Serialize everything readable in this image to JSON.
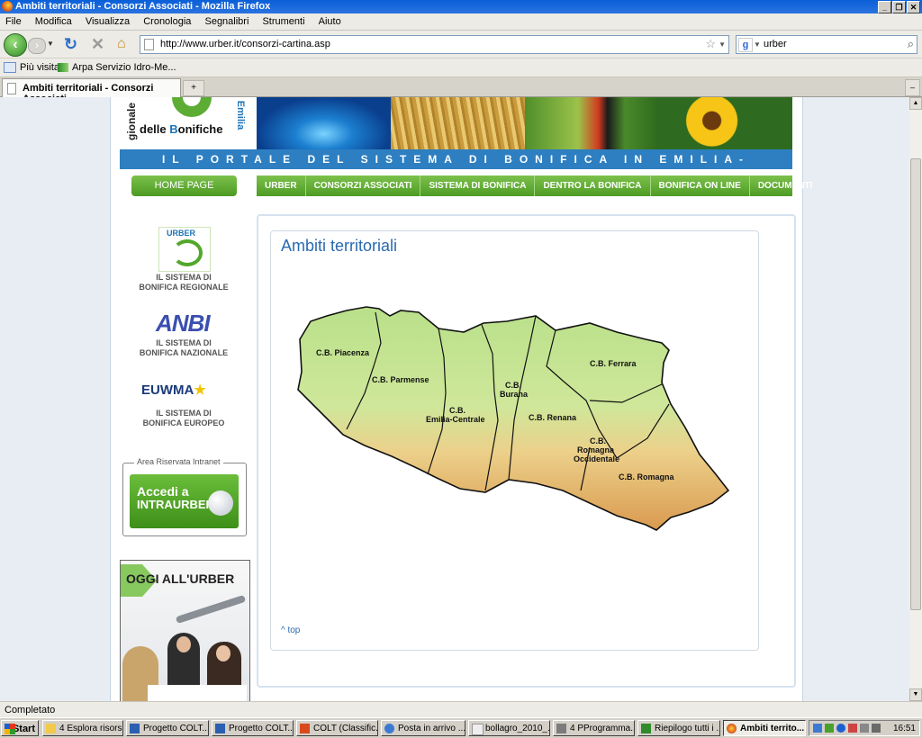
{
  "window": {
    "title": "Ambiti territoriali - Consorzi Associati - Mozilla Firefox",
    "controls": [
      "_",
      "❐",
      "✕"
    ]
  },
  "menu": [
    "File",
    "Modifica",
    "Visualizza",
    "Cronologia",
    "Segnalibri",
    "Strumenti",
    "Aiuto"
  ],
  "nav": {
    "url": "http://www.urber.it/consorzi-cartina.asp",
    "search_value": "urber",
    "search_engine": "g"
  },
  "bookmarks": [
    {
      "label": "Più visitati",
      "icon": "page-icon"
    },
    {
      "label": "Arpa Servizio Idro-Me...",
      "icon": "wave-icon"
    }
  ],
  "tabs": [
    {
      "label": "Ambiti territoriali - Consorzi Associati"
    }
  ],
  "site": {
    "logo": {
      "vertical_left": "gionale",
      "main_part1": "delle ",
      "main_b1": "B",
      "main_part2": "onifiche",
      "vertical_right": "Emilia"
    },
    "banner": "IL PORTALE DEL SISTEMA DI BONIFICA IN EMILIA-ROMAGNA",
    "home_button": "HOME PAGE",
    "topnav": [
      "URBER",
      "CONSORZI ASSOCIATI",
      "SISTEMA DI BONIFICA",
      "DENTRO LA BONIFICA",
      "BONIFICA ON LINE",
      "DOCUMENTI"
    ],
    "sidebar": {
      "urber_logo_text": "URBER",
      "urber_caption": [
        "IL SISTEMA DI",
        "BONIFICA REGIONALE"
      ],
      "anbi_logo_text": "ANBI",
      "anbi_caption": [
        "IL SISTEMA DI",
        "BONIFICA NAZIONALE"
      ],
      "euwma_logo_text": "EUWMA",
      "euwma_caption": [
        "IL SISTEMA DI",
        "BONIFICA EUROPEO"
      ],
      "intranet_legend": "Area Riservata Intranet",
      "intranet_line1": "Accedi a",
      "intranet_line2": "INTRAURBER",
      "oggi_title": "OGGI ALL'URBER"
    },
    "content": {
      "title": "Ambiti territoriali",
      "top_link": "^ top",
      "map_regions": [
        {
          "id": "piacenza",
          "lines": [
            "C.B. Piacenza"
          ]
        },
        {
          "id": "parmense",
          "lines": [
            "C.B. Parmense"
          ]
        },
        {
          "id": "emilia-centrale",
          "lines": [
            "C.B.",
            "Emilia-Centrale"
          ]
        },
        {
          "id": "burana",
          "lines": [
            "C.B.",
            "Burana"
          ]
        },
        {
          "id": "renana",
          "lines": [
            "C.B. Renana"
          ]
        },
        {
          "id": "ferrara",
          "lines": [
            "C.B. Ferrara"
          ]
        },
        {
          "id": "romagna-occidentale",
          "lines": [
            "C.B.",
            "Romagna",
            "Occidentale"
          ]
        },
        {
          "id": "romagna",
          "lines": [
            "C.B. Romagna"
          ]
        }
      ]
    }
  },
  "status": "Completato",
  "taskbar": {
    "start": "Start",
    "tasks": [
      "4 Esplora risorse",
      "Progetto COLT...",
      "Progetto COLT...",
      "COLT (Classific...",
      "Posta in arrivo ...",
      "bollagro_2010_...",
      "4 PProgramma...",
      "Riepilogo tutti i ...",
      "Ambiti territo..."
    ],
    "clock": "16:51"
  },
  "colors": {
    "accent_green": "#6bbd3a",
    "banner_blue": "#2d7fc1",
    "title_blue": "#2a6ab0",
    "map_plain": "#b9e08a",
    "map_hills": "#e4b46a"
  }
}
